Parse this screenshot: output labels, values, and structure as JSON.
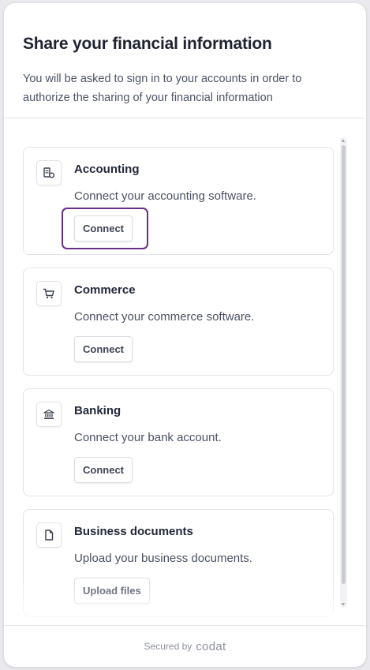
{
  "header": {
    "title": "Share your financial information",
    "subtitle": "You will be asked to sign in to your accounts in order to authorize the sharing of your financial information"
  },
  "cards": [
    {
      "title": "Accounting",
      "description": "Connect your accounting software.",
      "button": "Connect",
      "icon": "accounting-icon"
    },
    {
      "title": "Commerce",
      "description": "Connect your commerce software.",
      "button": "Connect",
      "icon": "cart-icon"
    },
    {
      "title": "Banking",
      "description": "Connect your bank account.",
      "button": "Connect",
      "icon": "bank-icon"
    },
    {
      "title": "Business documents",
      "description": "Upload your business documents.",
      "button": "Upload files",
      "icon": "document-icon"
    }
  ],
  "footer": {
    "secured_label": "Secured by",
    "brand": "codat"
  },
  "colors": {
    "focus_ring": "#6b2e86",
    "text_primary": "#1f2330",
    "text_secondary": "#4e5466"
  }
}
